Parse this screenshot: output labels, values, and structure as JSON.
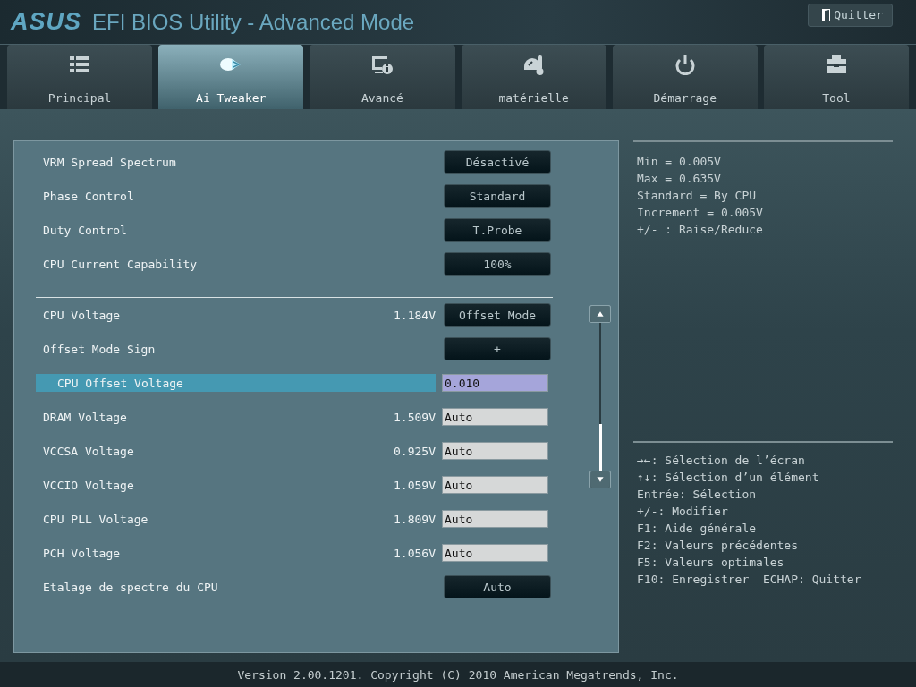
{
  "header": {
    "logo": "ASUS",
    "title": "EFI BIOS Utility - Advanced Mode",
    "quit_button": "Quitter"
  },
  "tabs": [
    {
      "label": "Principal",
      "selected": false
    },
    {
      "label": "Ai Tweaker",
      "selected": true
    },
    {
      "label": "Avancé",
      "selected": false
    },
    {
      "label": "matérielle",
      "selected": false
    },
    {
      "label": "Démarrage",
      "selected": false
    },
    {
      "label": "Tool",
      "selected": false
    }
  ],
  "settings": {
    "groups": [
      [
        {
          "label": "VRM Spread Spectrum",
          "kind": "button",
          "control": "Désactivé",
          "selected": false
        },
        {
          "label": "Phase Control",
          "kind": "button",
          "control": "Standard",
          "selected": false
        },
        {
          "label": "Duty Control",
          "kind": "button",
          "control": "T.Probe",
          "selected": false
        },
        {
          "label": "CPU Current Capability",
          "kind": "button",
          "control": "100%",
          "selected": false
        }
      ],
      [
        {
          "label": "CPU Voltage",
          "reading": "1.184V",
          "kind": "button",
          "control": "Offset Mode",
          "selected": false
        },
        {
          "label": "Offset Mode Sign",
          "kind": "button",
          "control": "+",
          "selected": false
        },
        {
          "label": "CPU Offset Voltage",
          "kind": "field",
          "control": "0.010",
          "selected": true
        },
        {
          "label": "DRAM Voltage",
          "reading": "1.509V",
          "kind": "field",
          "control": "Auto",
          "selected": false
        },
        {
          "label": "VCCSA Voltage",
          "reading": "0.925V",
          "kind": "field",
          "control": "Auto",
          "selected": false
        },
        {
          "label": "VCCIO Voltage",
          "reading": "1.059V",
          "kind": "field",
          "control": "Auto",
          "selected": false
        },
        {
          "label": "CPU PLL Voltage",
          "reading": "1.809V",
          "kind": "field",
          "control": "Auto",
          "selected": false
        },
        {
          "label": "PCH Voltage",
          "reading": "1.056V",
          "kind": "field",
          "control": "Auto",
          "selected": false
        },
        {
          "label": "Etalage de spectre du CPU",
          "kind": "button",
          "control": "Auto",
          "selected": false
        }
      ]
    ]
  },
  "help": {
    "description": [
      "Min = 0.005V",
      "Max = 0.635V",
      "Standard = By CPU",
      "Increment = 0.005V",
      "+/- : Raise/Reduce"
    ],
    "keys": [
      "→←: Sélection de l’écran",
      "↑↓: Sélection d’un élément",
      "Entrée: Sélection",
      "+/-: Modifier",
      "F1: Aide générale",
      "F2: Valeurs précédentes",
      "F5: Valeurs optimales",
      "F10: Enregistrer  ECHAP: Quitter"
    ]
  },
  "footer": {
    "version": "Version 2.00.1201. Copyright (C) 2010 American Megatrends, Inc."
  }
}
